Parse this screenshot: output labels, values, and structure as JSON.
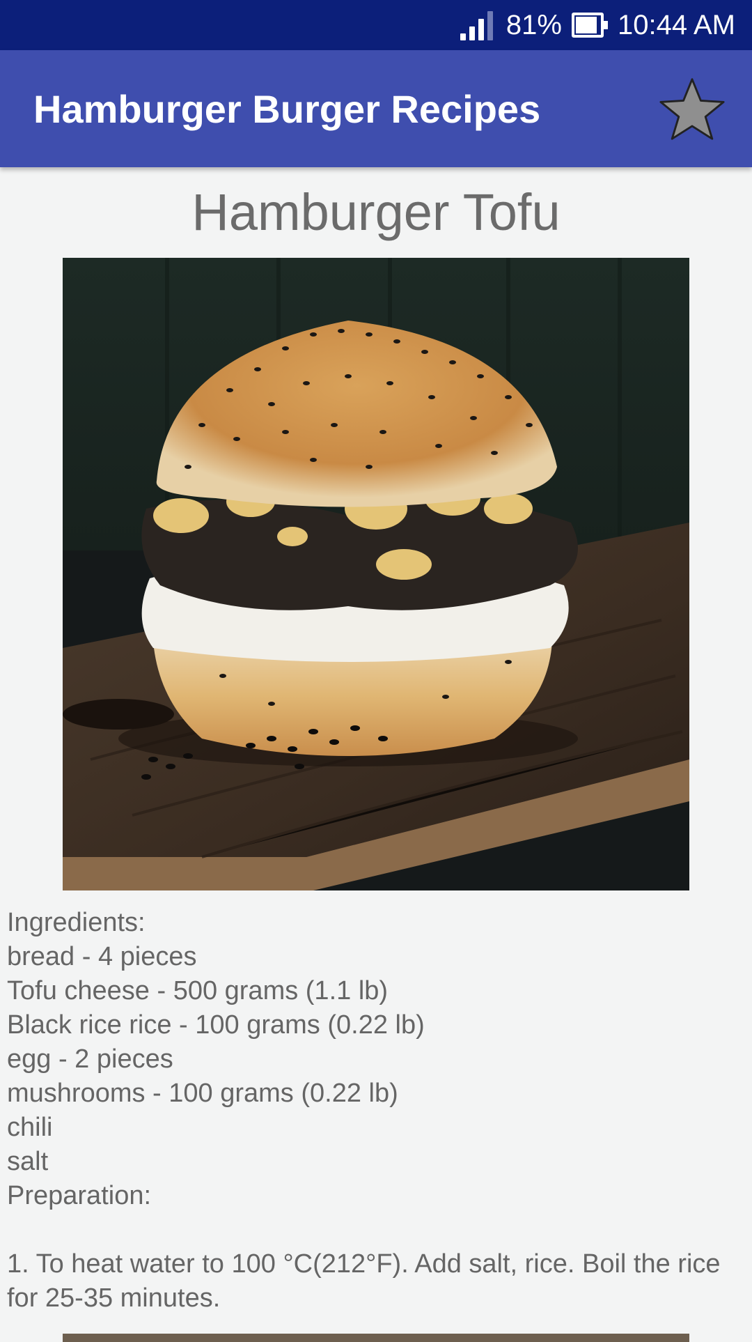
{
  "status_bar": {
    "battery": "81%",
    "time": "10:44 AM"
  },
  "app_bar": {
    "title": "Hamburger Burger Recipes",
    "favorite_icon": "star-icon"
  },
  "recipe": {
    "title": "Hamburger Tofu",
    "lines": [
      "Ingredients:",
      "bread - 4 pieces",
      "Tofu cheese - 500 grams (1.1 lb)",
      "Black rice rice - 100 grams (0.22 lb)",
      "egg - 2 pieces",
      "mushrooms - 100 grams (0.22 lb)",
      "chili",
      "salt",
      "Preparation:",
      "",
      "1. To heat water to 100 °C(212°F). Add salt, rice. Boil the rice for 25-35 minutes."
    ]
  },
  "colors": {
    "status_bar": "#0c1f7a",
    "app_bar": "#3f4eae",
    "background": "#f3f4f4",
    "text": "#656565"
  }
}
